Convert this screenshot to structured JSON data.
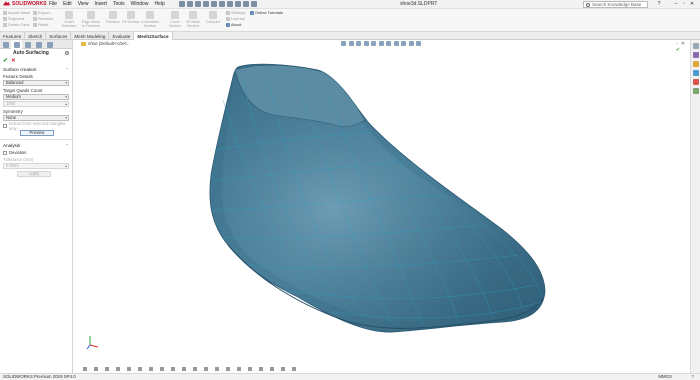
{
  "app": {
    "brand": "SOLIDWORKS",
    "menu": [
      "File",
      "Edit",
      "View",
      "Insert",
      "Tools",
      "Window",
      "Help"
    ],
    "doc_title": "shoe3d.SLDPRT",
    "search_placeholder": "Search Knowledge Base"
  },
  "ribbon": {
    "left_items": [
      "Import Mesh",
      "Segment",
      "Delete Face",
      "Export...",
      "Remesh",
      "Reset"
    ],
    "big_items": [
      "Smart Selection",
      "Edge Mesh to Freeform",
      "Freeform",
      "Fit Surface",
      "Automated Surface",
      "Curve Section",
      "3D Mesh Section",
      "Compare"
    ],
    "settings": "Settings",
    "license": "License",
    "online_tutorials": "Online Tutorials",
    "about": "About"
  },
  "tabs": [
    "Features",
    "Sketch",
    "Surfaces",
    "Mesh Modeling",
    "Evaluate",
    "Mesh2Surface"
  ],
  "active_tab": "Mesh2Surface",
  "panel": {
    "title": "Auto Surfacing",
    "surface_creation": "Surface creation",
    "feature_details": "Feature Details",
    "feature_details_value": "Balanced",
    "target_quads_count": "Target Quads Count",
    "target_quads_value": "Medium",
    "target_quads_number": "1000",
    "symmetry": "Symmetry",
    "symmetry_value": "None",
    "extract_selected": "Extract from selected triangles only",
    "preview": "Preview",
    "analysis": "Analysis",
    "deviation": "Deviation",
    "tolerance_label": "Tolerance (mm)",
    "tolerance_value": "0.5mm",
    "apply": "Apply"
  },
  "viewport": {
    "tree_label": "shoe (Default<<Def..."
  },
  "status": {
    "left": "SOLIDWORKS Premium 2019 SP4.0",
    "units": "MMGS"
  },
  "colors": {
    "model": "#3c6f8a",
    "accent": "#c8102e"
  }
}
